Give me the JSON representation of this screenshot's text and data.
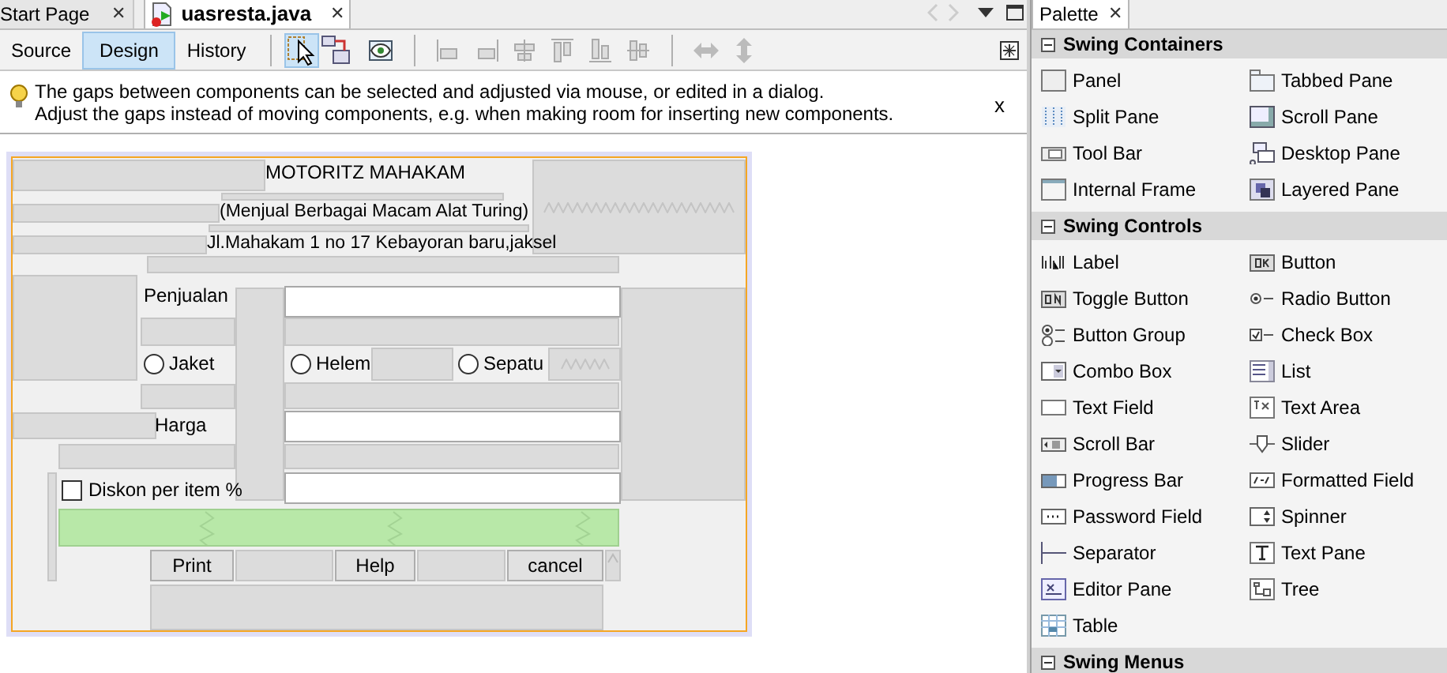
{
  "editor_tabs": [
    {
      "label": "Start Page",
      "selected": false,
      "close": "✕"
    },
    {
      "label": "uasresta.java",
      "selected": true,
      "close": "✕"
    }
  ],
  "view_tabs": [
    {
      "label": "Source",
      "selected": false
    },
    {
      "label": "Design",
      "selected": true
    },
    {
      "label": "History",
      "selected": false
    }
  ],
  "mode_buttons": [
    {
      "selected": true
    },
    {
      "selected": false
    }
  ],
  "hint": {
    "lines": [
      "The gaps between components can be selected and adjusted via mouse, or edited in a dialog.",
      "Adjust the gaps instead of moving components, e.g. when making room for inserting new components."
    ],
    "close": "x"
  },
  "form": {
    "components": [
      {
        "kind": "label",
        "text": "MOTORITZ MAHAKAM"
      },
      {
        "kind": "label",
        "text": "(Menjual Berbagai Macam Alat Turing)"
      },
      {
        "kind": "label",
        "text": "Jl.Mahakam 1 no 17 Kebayoran baru,jaksel"
      },
      {
        "kind": "label",
        "text": "Penjualan"
      },
      {
        "kind": "field"
      },
      {
        "kind": "radio",
        "text": "Jaket",
        "selected": false
      },
      {
        "kind": "radio",
        "text": "Helem",
        "selected": false
      },
      {
        "kind": "radio",
        "text": "Sepatu",
        "selected": false
      },
      {
        "kind": "label",
        "text": "Harga"
      },
      {
        "kind": "field"
      },
      {
        "kind": "checkbox",
        "text": "Diskon per item %",
        "checked": false
      },
      {
        "kind": "field"
      },
      {
        "kind": "button",
        "text": "Print"
      },
      {
        "kind": "button",
        "text": "Help"
      },
      {
        "kind": "button",
        "text": "cancel"
      }
    ]
  },
  "palette": {
    "title": "Palette",
    "close": "✕",
    "sections": [
      {
        "title": "Swing Containers",
        "expanded": true,
        "items": [
          "Panel",
          "Tabbed Pane",
          "Split Pane",
          "Scroll Pane",
          "Tool Bar",
          "Desktop Pane",
          "Internal Frame",
          "Layered Pane"
        ]
      },
      {
        "title": "Swing Controls",
        "expanded": true,
        "items": [
          "Label",
          "Button",
          "Toggle Button",
          "Radio Button",
          "Button Group",
          "Check Box",
          "Combo Box",
          "List",
          "Text Field",
          "Text Area",
          "Scroll Bar",
          "Slider",
          "Progress Bar",
          "Formatted Field",
          "Password Field",
          "Spinner",
          "Separator",
          "Text Pane",
          "Editor Pane",
          "Tree",
          "Table"
        ]
      },
      {
        "title": "Swing Menus",
        "expanded": true
      }
    ]
  }
}
